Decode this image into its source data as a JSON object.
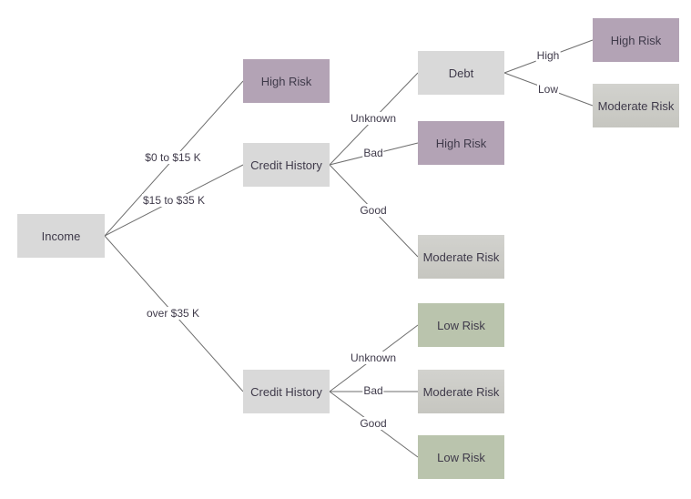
{
  "diagram": {
    "type": "decision-tree",
    "colors": {
      "decision": "#d9d9d9",
      "high_risk": "#b3a3b5",
      "moderate_risk": "#cbcbc6",
      "low_risk": "#bac4ad",
      "connector": "#6e6e6e"
    },
    "nodes": {
      "income": "Income",
      "high_risk_1": "High Risk",
      "credit_history_1": "Credit History",
      "credit_history_2": "Credit History",
      "debt": "Debt",
      "high_risk_2": "High Risk",
      "high_risk_3": "High Risk",
      "moderate_risk_1": "Moderate Risk",
      "moderate_risk_2": "Moderate Risk",
      "moderate_risk_3": "Moderate Risk",
      "low_risk_1": "Low Risk",
      "low_risk_2": "Low Risk"
    },
    "edges": {
      "income_0_15": "$0 to $15 K",
      "income_15_35": "$15 to $35 K",
      "income_over_35": "over $35 K",
      "ch1_unknown": "Unknown",
      "ch1_bad": "Bad",
      "ch1_good": "Good",
      "debt_high": "High",
      "debt_low": "Low",
      "ch2_unknown": "Unknown",
      "ch2_bad": "Bad",
      "ch2_good": "Good"
    }
  }
}
